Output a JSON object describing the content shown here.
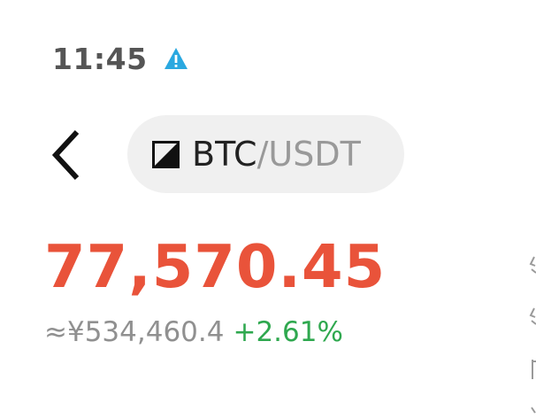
{
  "status_bar": {
    "time": "11:45",
    "alert_icon": "warning-triangle-icon",
    "alert_color": "#2aa8e0"
  },
  "header": {
    "back_icon": "chevron-left-icon",
    "pair": {
      "icon": "exchange-logo-icon",
      "base": "BTC",
      "separator": "/",
      "quote": "USDT"
    }
  },
  "ticker": {
    "price": "77,570.45",
    "price_color": "#e9533a",
    "fiat_value": "≈¥534,460.4",
    "change_percent": "+2.61%",
    "change_color": "#2fa84f"
  }
}
